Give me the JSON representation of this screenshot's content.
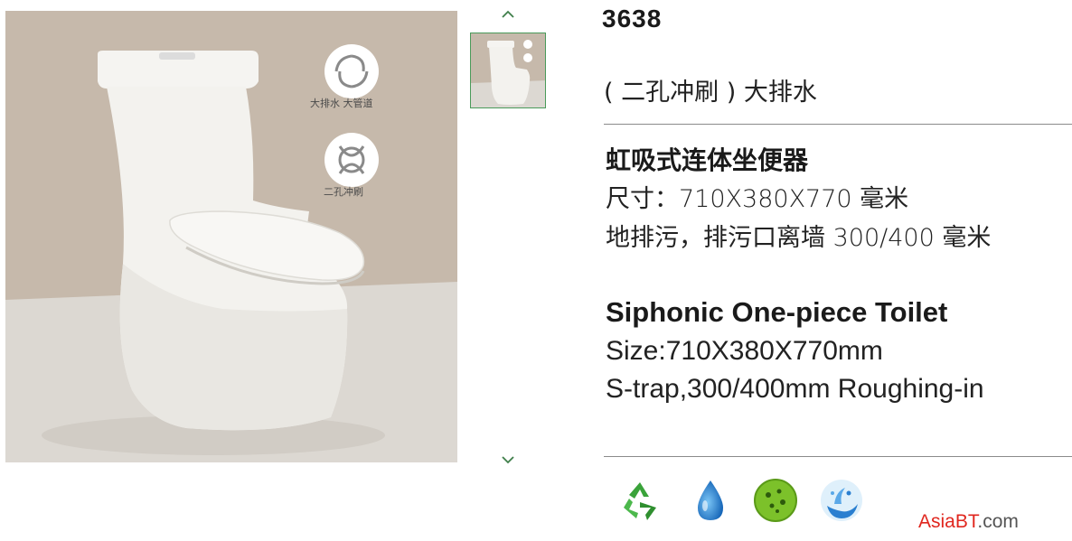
{
  "product": {
    "model": "3638",
    "subtitle": "( 二孔冲刷 ) 大排水",
    "cn_title": "虹吸式连体坐便器",
    "cn_size": "尺寸：710X380X770 毫米",
    "cn_trap": "地排污，排污口离墙 300/400 毫米",
    "en_title": "Siphonic One-piece Toilet",
    "en_size": "Size:710X380X770mm",
    "en_trap": "S-trap,300/400mm Roughing-in"
  },
  "image_badges": {
    "badge1_caption": "大排水 大管道",
    "badge2_caption": "二孔冲刷"
  },
  "gallery": {
    "up_icon": "chevron-up-icon",
    "down_icon": "chevron-down-icon",
    "thumbnail_count": 1,
    "active_thumbnail": 1,
    "thumb_border_color": "#4a9a5a"
  },
  "features": [
    {
      "icon": "recycle-icon",
      "color": "#3aa33a"
    },
    {
      "icon": "water-drop-icon",
      "color": "#1e88d8"
    },
    {
      "icon": "antibacterial-icon",
      "color": "#7cc12a"
    },
    {
      "icon": "water-splash-icon",
      "color": "#2a7fd0"
    }
  ],
  "brand": {
    "red_part": "AsiaBT",
    "grey_part": ".com",
    "red_color": "#e0261e"
  }
}
